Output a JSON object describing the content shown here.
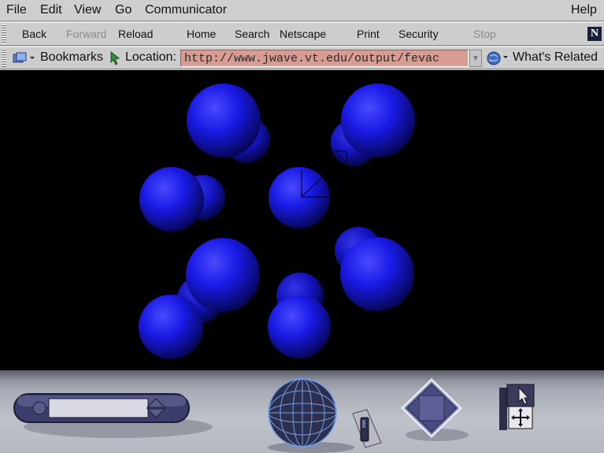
{
  "menubar": {
    "file": "File",
    "edit": "Edit",
    "view": "View",
    "go": "Go",
    "communicator": "Communicator",
    "help": "Help"
  },
  "toolbar": {
    "back": "Back",
    "forward": "Forward",
    "reload": "Reload",
    "home": "Home",
    "search": "Search",
    "netscape": "Netscape",
    "print": "Print",
    "security": "Security",
    "stop": "Stop",
    "logo": "N"
  },
  "location_bar": {
    "bookmarks_label": "Bookmarks",
    "location_label": "Location:",
    "url": "http://www.jwave.vt.edu/output/fevac",
    "whats_related": "What's Related"
  },
  "colors": {
    "url_field_bg": "#d99c93",
    "sphere": "#1515e0",
    "scene_bg": "#000000"
  },
  "icons": [
    "bookmarks-icon",
    "location-icon",
    "whats-related-icon",
    "netscape-logo-icon",
    "dropdown-arrow-icon",
    "vrml-sphere-navigator-icon",
    "vrml-diamond-control-icon",
    "select-arrow-icon",
    "move-cross-icon"
  ]
}
